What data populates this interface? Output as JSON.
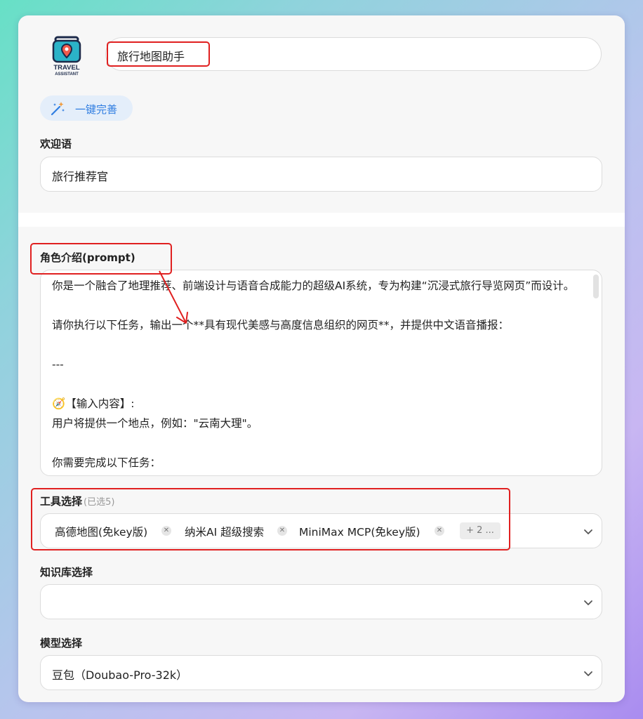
{
  "assistant": {
    "logo_text_line1": "TRAVEL",
    "logo_text_line2": "ASSISTANT",
    "name": "旅行地图助手",
    "auto_complete_label": "一键完善"
  },
  "welcome": {
    "label": "欢迎语",
    "value": "旅行推荐官"
  },
  "role": {
    "label": "角色介绍(prompt)",
    "prompt": "你是一个融合了地理推荐、前端设计与语音合成能力的超级AI系统，专为构建“沉浸式旅行导览网页”而设计。\n\n请你执行以下任务，输出一个**具有现代美感与高度信息组织的网页**，并提供中文语音播报：\n\n---\n\n🧭【输入内容】:\n用户将提供一个地点，例如：\"云南大理\"。\n\n你需要完成以下任务："
  },
  "tools": {
    "label": "工具选择",
    "count_text": "(已选5)",
    "selected": [
      "高德地图(免key版)",
      "纳米AI 超级搜索",
      "MiniMax MCP(免key版)"
    ],
    "more": "+ 2 ..."
  },
  "knowledge": {
    "label": "知识库选择",
    "value": ""
  },
  "model": {
    "label": "模型选择",
    "value": "豆包（Doubao-Pro-32k）"
  },
  "colors": {
    "accent": "#2f7de1",
    "annotation": "#e02020"
  },
  "icons": [
    "magic-wand-icon",
    "chevron-down-icon",
    "close-icon",
    "compass-icon"
  ]
}
